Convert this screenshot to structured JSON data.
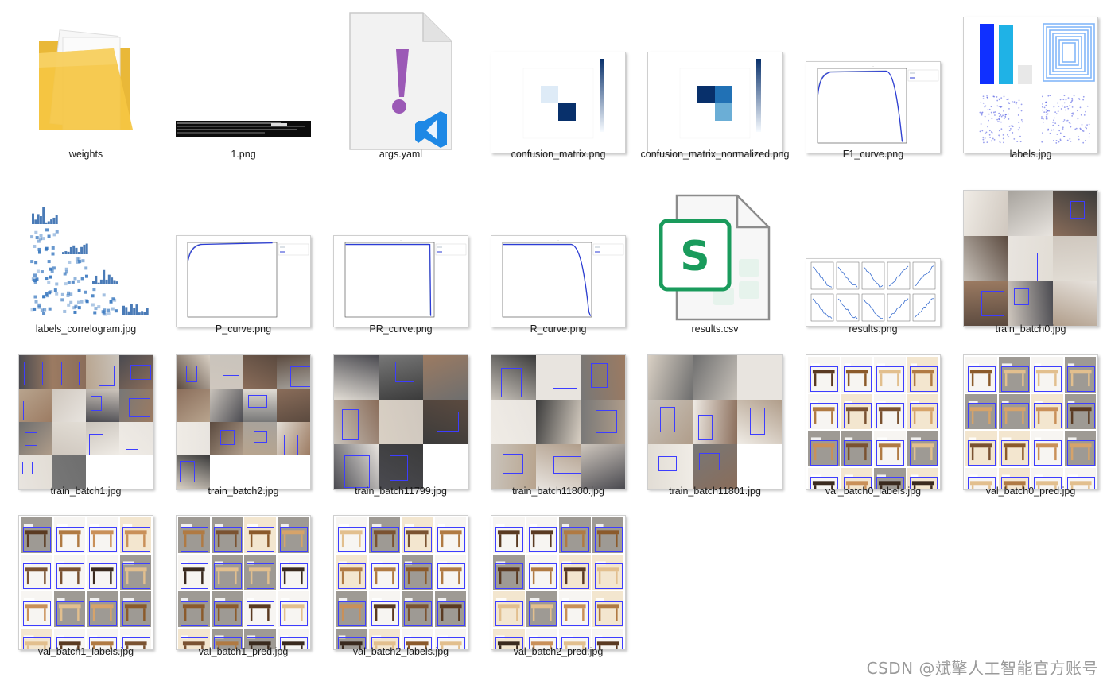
{
  "files": [
    {
      "name": "weights",
      "kind": "folder"
    },
    {
      "name": "1.png",
      "kind": "terminal"
    },
    {
      "name": "args.yaml",
      "kind": "yaml"
    },
    {
      "name": "confusion_matrix.png",
      "kind": "cm"
    },
    {
      "name": "confusion_matrix_normalized.png",
      "kind": "cmn"
    },
    {
      "name": "F1_curve.png",
      "kind": "curve"
    },
    {
      "name": "labels.jpg",
      "kind": "labels"
    },
    {
      "name": "labels_correlogram.jpg",
      "kind": "correlogram"
    },
    {
      "name": "P_curve.png",
      "kind": "curve"
    },
    {
      "name": "PR_curve.png",
      "kind": "pr"
    },
    {
      "name": "R_curve.png",
      "kind": "curve"
    },
    {
      "name": "results.csv",
      "kind": "csv"
    },
    {
      "name": "results.png",
      "kind": "results"
    },
    {
      "name": "train_batch0.jpg",
      "kind": "photos"
    },
    {
      "name": "train_batch1.jpg",
      "kind": "photos"
    },
    {
      "name": "train_batch2.jpg",
      "kind": "photos"
    },
    {
      "name": "train_batch11799.jpg",
      "kind": "photos"
    },
    {
      "name": "train_batch11800.jpg",
      "kind": "photos"
    },
    {
      "name": "train_batch11801.jpg",
      "kind": "photos"
    },
    {
      "name": "val_batch0_labels.jpg",
      "kind": "val"
    },
    {
      "name": "val_batch0_pred.jpg",
      "kind": "val"
    },
    {
      "name": "val_batch1_labels.jpg",
      "kind": "val"
    },
    {
      "name": "val_batch1_pred.jpg",
      "kind": "val"
    },
    {
      "name": "val_batch2_labels.jpg",
      "kind": "val"
    },
    {
      "name": "val_batch2_pred.jpg",
      "kind": "val"
    }
  ],
  "icons": {
    "folder": "folder-icon",
    "yaml": "vscode-file-icon",
    "csv": "spreadsheet-file-icon"
  },
  "colors": {
    "folder": "#f5c542",
    "yaml_mark": "#9b59b6",
    "vscode": "#1e88e5",
    "csv": "#1a9b5c",
    "curve": "#2b3bd6",
    "heat": "#08306b"
  },
  "watermark": "CSDN @斌擎人工智能官方账号"
}
